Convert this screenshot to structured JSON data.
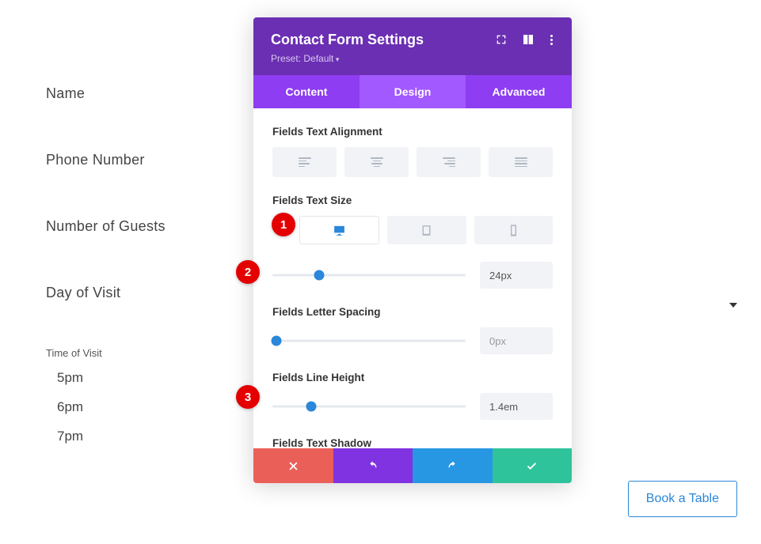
{
  "form": {
    "fields": [
      "Name",
      "Phone Number",
      "Number of Guests",
      "Day of Visit"
    ],
    "time_header": "Time of Visit",
    "times": [
      "5pm",
      "6pm",
      "7pm"
    ]
  },
  "modal": {
    "title": "Contact Form Settings",
    "preset": "Preset: Default",
    "tabs": {
      "content": "Content",
      "design": "Design",
      "advanced": "Advanced",
      "active": "design"
    },
    "sections": {
      "alignment": {
        "label": "Fields Text Alignment"
      },
      "size": {
        "label": "Fields Text Size",
        "value": "24px",
        "slider_pct": 24
      },
      "spacing": {
        "label": "Fields Letter Spacing",
        "value": "0px",
        "slider_pct": 2
      },
      "lineheight": {
        "label": "Fields Line Height",
        "value": "1.4em",
        "slider_pct": 20
      },
      "shadow": {
        "label": "Fields Text Shadow"
      }
    }
  },
  "annotations": {
    "a1": "1",
    "a2": "2",
    "a3": "3"
  },
  "cta": {
    "book": "Book a Table"
  }
}
